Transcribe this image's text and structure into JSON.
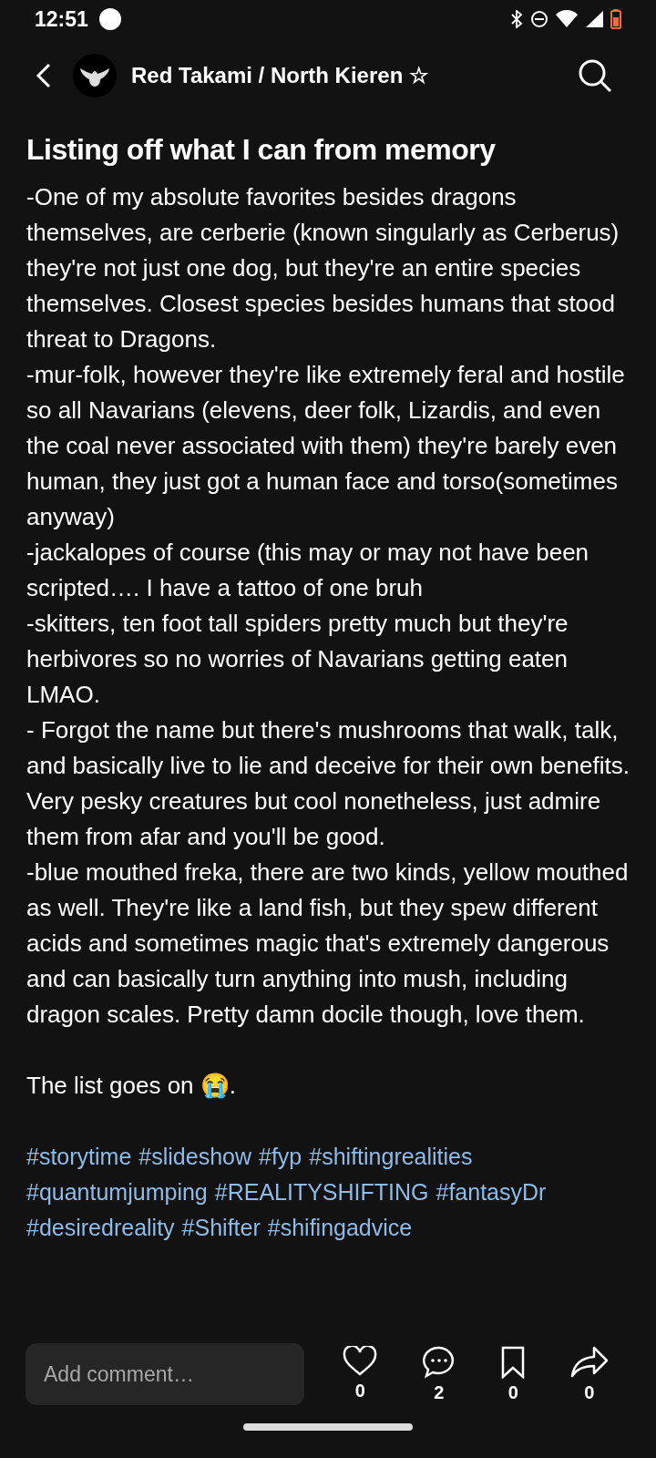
{
  "status_bar": {
    "time": "12:51"
  },
  "header": {
    "author": "Red Takami / North Kieren ☆"
  },
  "post": {
    "title": "Listing off what I can from memory",
    "paragraphs": [
      "-One of my absolute favorites besides dragons themselves, are cerberie (known singularly as Cerberus) they're not just one dog, but they're an entire species themselves. Closest species besides humans that stood threat to Dragons.",
      "-mur-folk, however they're like extremely feral and hostile so all Navarians (elevens, deer folk, Lizardis, and even the coal never associated with them) they're barely even human, they just got a human face and torso(sometimes anyway)",
      "-jackalopes of course (this may or may not have been scripted…. I have a tattoo of one bruh",
      "-skitters, ten foot tall spiders pretty much but they're herbivores so no worries of Navarians getting eaten LMAO.",
      "- Forgot the name but there's mushrooms that walk, talk, and basically live to lie and deceive for their own benefits. Very pesky creatures but cool nonetheless, just admire them from afar and you'll be good.",
      "-blue mouthed freka, there are two kinds, yellow mouthed as well. They're like a land fish, but they spew different acids and sometimes magic that's extremely dangerous and can basically turn anything into mush, including dragon scales. Pretty damn docile though, love them."
    ],
    "closing": "The list goes on 😭.",
    "hashtags": [
      "#storytime",
      "#slideshow",
      "#fyp",
      "#shiftingrealities",
      "#quantumjumping",
      "#REALITYSHIFTING",
      "#fantasyDr",
      "#desiredreality",
      "#Shifter",
      "#shifingadvice"
    ]
  },
  "bottom_bar": {
    "comment": {
      "placeholder": "Add comment…"
    },
    "actions": [
      {
        "kind": "like",
        "count": "0"
      },
      {
        "kind": "comment",
        "count": "2"
      },
      {
        "kind": "save",
        "count": "0"
      },
      {
        "kind": "share",
        "count": "0"
      }
    ]
  }
}
